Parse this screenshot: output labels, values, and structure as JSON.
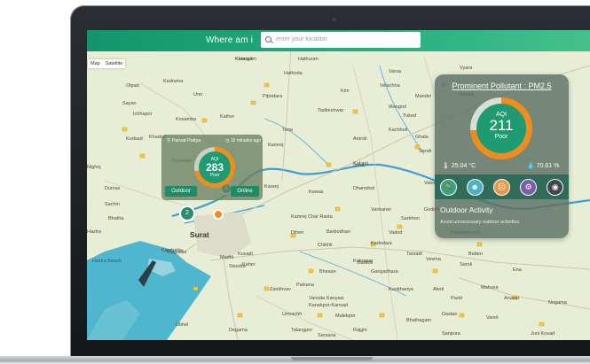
{
  "header": {
    "title": "Where am i",
    "search_placeholder": "enter your location"
  },
  "map_type": {
    "map": "Map",
    "satellite": "Satellite"
  },
  "map_labels": {
    "places": [
      "Kharach",
      "Hathoda",
      "Hathuran",
      "Varsa",
      "Pipodara",
      "Kim",
      "Mangrol",
      "Kudsad",
      "Nighoj",
      "Kadrama",
      "Kosamba",
      "Kathor",
      "Kamrej",
      "Olpad",
      "Tadkeshwar",
      "Velachha",
      "Mandvi",
      "Tuked",
      "Vankal",
      "Ghala",
      "Sandi",
      "Kukani",
      "Bardoli",
      "Madhi",
      "Karchelia",
      "Bhatha",
      "Hazira",
      "Magdalla",
      "Sachin",
      "Dumas",
      "Dihen",
      "Barbodhan",
      "Kadodara",
      "Palsana",
      "Vesma",
      "Saroli",
      "Sisodra",
      "Jolva",
      "Bhesan",
      "Kunbhariya",
      "Ena",
      "Anaval",
      "Unai",
      "Vyara",
      "Zankhvav",
      "Kakrapar",
      "Pardi",
      "Kanakpur-Kansad",
      "Umrachh",
      "Nogama",
      "Kaher",
      "Kuvadi",
      "Sayan",
      "Ichhapor",
      "Kunvada",
      "Malekpor",
      "Bhathagam",
      "Dastan",
      "Mahuva",
      "Valod",
      "Vankaner",
      "Chikhli",
      "Antroli",
      "Goddha",
      "Vadod",
      "Bajipura",
      "Karanj",
      "Kawas",
      "Kamrej Char Rasta",
      "Dhamdod",
      "Sarbhon",
      "Padamdungri",
      "Baben",
      "Gangadhara",
      "Kanyasi",
      "Tarsadi",
      "Akoti",
      "Vareli",
      "Juni Kosad",
      "Sarsana",
      "Talangpor",
      "Rajgiri",
      "Sanpura",
      "Degama",
      "Ubhel",
      "Khadod",
      "Unn",
      "Tena",
      "Kachholi",
      "Vansda",
      "Katargam"
    ],
    "city": "Surat",
    "water_label": "Hazira Beach"
  },
  "local_card": {
    "location": "Parvat Patiya",
    "time_ago": "10 minutes ago",
    "aqi_label": "AQI",
    "aqi_value": "283",
    "aqi_status": "Poor",
    "outdoor_button": "Outdoor",
    "online_button": "Online"
  },
  "map_markers": {
    "marker_a": "8",
    "marker_b": "2"
  },
  "pollution_panel": {
    "title": "Prominent Pollutant : PM2.5",
    "aqi_label": "AQI",
    "aqi_value": "211",
    "aqi_status": "Poor",
    "temperature": "25.04 °C",
    "humidity": "70.61 %",
    "activities": [
      "running-icon",
      "person-icon",
      "mask-icon",
      "cycling-icon",
      "car-icon"
    ],
    "activity_title": "Outdoor Activity",
    "activity_advice": "Avoid unnecessary outdoor activities"
  },
  "colors": {
    "accent": "#1f9b73",
    "warning": "#f28c1b",
    "header_start": "#14946b",
    "header_end": "#45c08e"
  }
}
